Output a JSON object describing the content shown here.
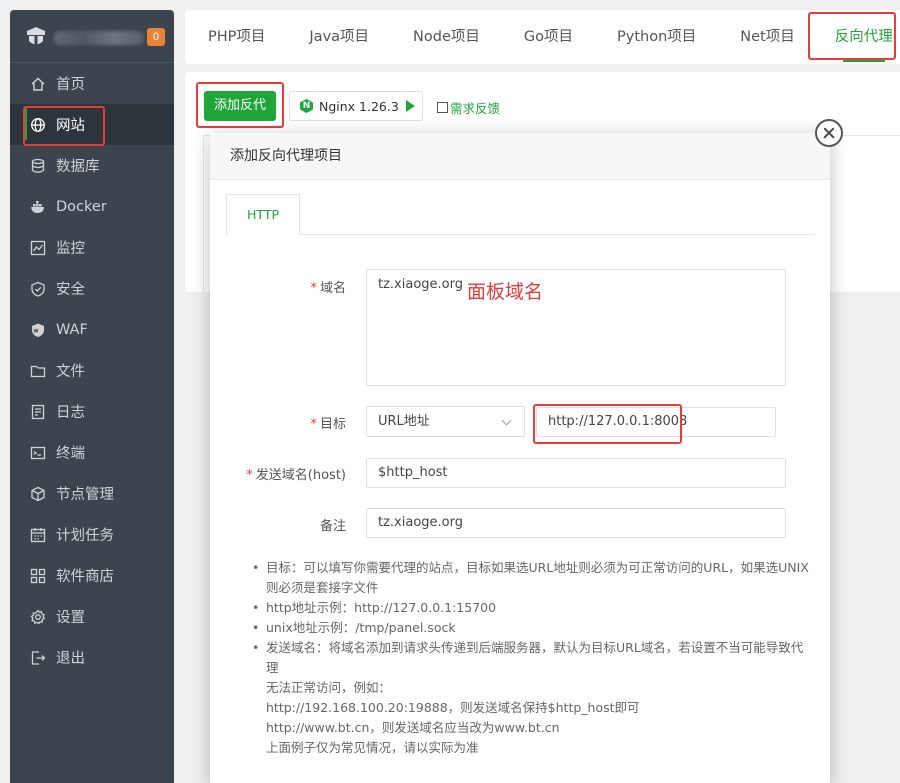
{
  "sidebar": {
    "badge": "0",
    "items": [
      {
        "label": "首页",
        "icon": "home-icon"
      },
      {
        "label": "网站",
        "icon": "globe-icon",
        "active": true
      },
      {
        "label": "数据库",
        "icon": "database-icon"
      },
      {
        "label": "Docker",
        "icon": "docker-icon"
      },
      {
        "label": "监控",
        "icon": "monitor-icon"
      },
      {
        "label": "安全",
        "icon": "shield-icon"
      },
      {
        "label": "WAF",
        "icon": "waf-shield-icon"
      },
      {
        "label": "文件",
        "icon": "folder-icon"
      },
      {
        "label": "日志",
        "icon": "log-icon"
      },
      {
        "label": "终端",
        "icon": "terminal-icon"
      },
      {
        "label": "节点管理",
        "icon": "cube-icon"
      },
      {
        "label": "计划任务",
        "icon": "calendar-icon"
      },
      {
        "label": "软件商店",
        "icon": "grid-icon"
      },
      {
        "label": "设置",
        "icon": "gear-icon"
      },
      {
        "label": "退出",
        "icon": "logout-icon"
      }
    ]
  },
  "tabs": [
    "PHP项目",
    "Java项目",
    "Node项目",
    "Go项目",
    "Python项目",
    "Net项目",
    "反向代理"
  ],
  "toolbar": {
    "add_button": "添加反代",
    "nginx_version": "Nginx 1.26.3",
    "feedback": "需求反馈"
  },
  "modal": {
    "title": "添加反向代理项目",
    "tab": "HTTP",
    "domain_label": "域名",
    "domain_value": "tz.xiaoge.org",
    "annotation": "面板域名",
    "target_label": "目标",
    "target_type": "URL地址",
    "target_value": "http://127.0.0.1:8008",
    "host_label": "发送域名(host)",
    "host_value": "$http_host",
    "remark_label": "备注",
    "remark_value": "tz.xiaoge.org",
    "tips": {
      "t1_a": "目标：可以填写你需要代理的站点，目标如果选URL地址则必须为可正常访问的URL，如果选UNIX",
      "t1_b": "则必须是套接字文件",
      "t2": "http地址示例：http://127.0.0.1:15700",
      "t3": "unix地址示例：/tmp/panel.sock",
      "t4_a": "发送域名：将域名添加到请求头传递到后端服务器，默认为目标URL域名，若设置不当可能导致代理",
      "t4_b": "无法正常访问，例如：",
      "t4_c": "http://192.168.100.20:19888，则发送域名保持$http_host即可",
      "t4_d": "http://www.bt.cn，则发送域名应当改为www.bt.cn",
      "t4_e": "上面例子仅为常见情况，请以实际为准"
    }
  },
  "colors": {
    "accent": "#20a53a",
    "sidebar": "#3c444d",
    "highlight": "#e53c3c"
  }
}
